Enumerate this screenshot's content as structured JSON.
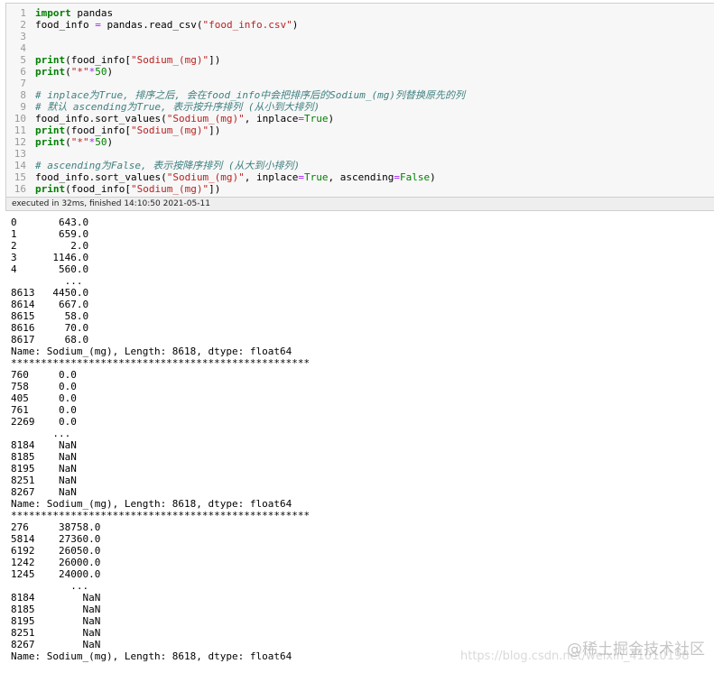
{
  "code_lines": [
    {
      "n": "1",
      "tokens": [
        {
          "t": "import",
          "c": "kw"
        },
        {
          "t": " pandas",
          "c": "plain"
        }
      ]
    },
    {
      "n": "2",
      "tokens": [
        {
          "t": "food_info ",
          "c": "plain"
        },
        {
          "t": "=",
          "c": "op"
        },
        {
          "t": " pandas.read_csv(",
          "c": "plain"
        },
        {
          "t": "\"food_info.csv\"",
          "c": "str"
        },
        {
          "t": ")",
          "c": "plain"
        }
      ]
    },
    {
      "n": "3",
      "tokens": []
    },
    {
      "n": "4",
      "tokens": []
    },
    {
      "n": "5",
      "tokens": [
        {
          "t": "print",
          "c": "fn"
        },
        {
          "t": "(food_info[",
          "c": "plain"
        },
        {
          "t": "\"Sodium_(mg)\"",
          "c": "str"
        },
        {
          "t": "])",
          "c": "plain"
        }
      ]
    },
    {
      "n": "6",
      "tokens": [
        {
          "t": "print",
          "c": "fn"
        },
        {
          "t": "(",
          "c": "plain"
        },
        {
          "t": "\"*\"",
          "c": "str"
        },
        {
          "t": "*",
          "c": "op"
        },
        {
          "t": "50",
          "c": "num"
        },
        {
          "t": ")",
          "c": "plain"
        }
      ]
    },
    {
      "n": "7",
      "tokens": []
    },
    {
      "n": "8",
      "tokens": [
        {
          "t": "# inplace为True, 排序之后, 会在food_info中会把排序后的Sodium_(mg)列替换原先的列",
          "c": "cm"
        }
      ]
    },
    {
      "n": "9",
      "tokens": [
        {
          "t": "# 默认 ascending为True, 表示按升序排列 (从小到大排列)",
          "c": "cm"
        }
      ]
    },
    {
      "n": "10",
      "tokens": [
        {
          "t": "food_info.sort_values(",
          "c": "plain"
        },
        {
          "t": "\"Sodium_(mg)\"",
          "c": "str"
        },
        {
          "t": ", inplace",
          "c": "plain"
        },
        {
          "t": "=",
          "c": "op"
        },
        {
          "t": "True",
          "c": "bool"
        },
        {
          "t": ")",
          "c": "plain"
        }
      ]
    },
    {
      "n": "11",
      "tokens": [
        {
          "t": "print",
          "c": "fn"
        },
        {
          "t": "(food_info[",
          "c": "plain"
        },
        {
          "t": "\"Sodium_(mg)\"",
          "c": "str"
        },
        {
          "t": "])",
          "c": "plain"
        }
      ]
    },
    {
      "n": "12",
      "tokens": [
        {
          "t": "print",
          "c": "fn"
        },
        {
          "t": "(",
          "c": "plain"
        },
        {
          "t": "\"*\"",
          "c": "str"
        },
        {
          "t": "*",
          "c": "op"
        },
        {
          "t": "50",
          "c": "num"
        },
        {
          "t": ")",
          "c": "plain"
        }
      ]
    },
    {
      "n": "13",
      "tokens": []
    },
    {
      "n": "14",
      "tokens": [
        {
          "t": "# ascending为False, 表示按降序排列 (从大到小排列)",
          "c": "cm"
        }
      ]
    },
    {
      "n": "15",
      "tokens": [
        {
          "t": "food_info.sort_values(",
          "c": "plain"
        },
        {
          "t": "\"Sodium_(mg)\"",
          "c": "str"
        },
        {
          "t": ", inplace",
          "c": "plain"
        },
        {
          "t": "=",
          "c": "op"
        },
        {
          "t": "True",
          "c": "bool"
        },
        {
          "t": ", ascending",
          "c": "plain"
        },
        {
          "t": "=",
          "c": "op"
        },
        {
          "t": "False",
          "c": "bool"
        },
        {
          "t": ")",
          "c": "plain"
        }
      ]
    },
    {
      "n": "16",
      "tokens": [
        {
          "t": "print",
          "c": "fn"
        },
        {
          "t": "(food_info[",
          "c": "plain"
        },
        {
          "t": "\"Sodium_(mg)\"",
          "c": "str"
        },
        {
          "t": "])",
          "c": "plain"
        }
      ]
    }
  ],
  "exec_status": "executed in 32ms, finished 14:10:50 2021-05-11",
  "output_lines": [
    "0       643.0",
    "1       659.0",
    "2         2.0",
    "3      1146.0",
    "4       560.0",
    "         ...",
    "8613   4450.0",
    "8614    667.0",
    "8615     58.0",
    "8616     70.0",
    "8617     68.0",
    "Name: Sodium_(mg), Length: 8618, dtype: float64",
    "**************************************************",
    "760     0.0",
    "758     0.0",
    "405     0.0",
    "761     0.0",
    "2269    0.0",
    "       ...",
    "8184    NaN",
    "8185    NaN",
    "8195    NaN",
    "8251    NaN",
    "8267    NaN",
    "Name: Sodium_(mg), Length: 8618, dtype: float64",
    "**************************************************",
    "276     38758.0",
    "5814    27360.0",
    "6192    26050.0",
    "1242    26000.0",
    "1245    24000.0",
    "          ...",
    "8184        NaN",
    "8185        NaN",
    "8195        NaN",
    "8251        NaN",
    "8267        NaN",
    "Name: Sodium_(mg), Length: 8618, dtype: float64"
  ],
  "watermark": {
    "brand": "@稀土掘金技术社区",
    "url": "https://blog.csdn.net/weixin_41010198"
  }
}
